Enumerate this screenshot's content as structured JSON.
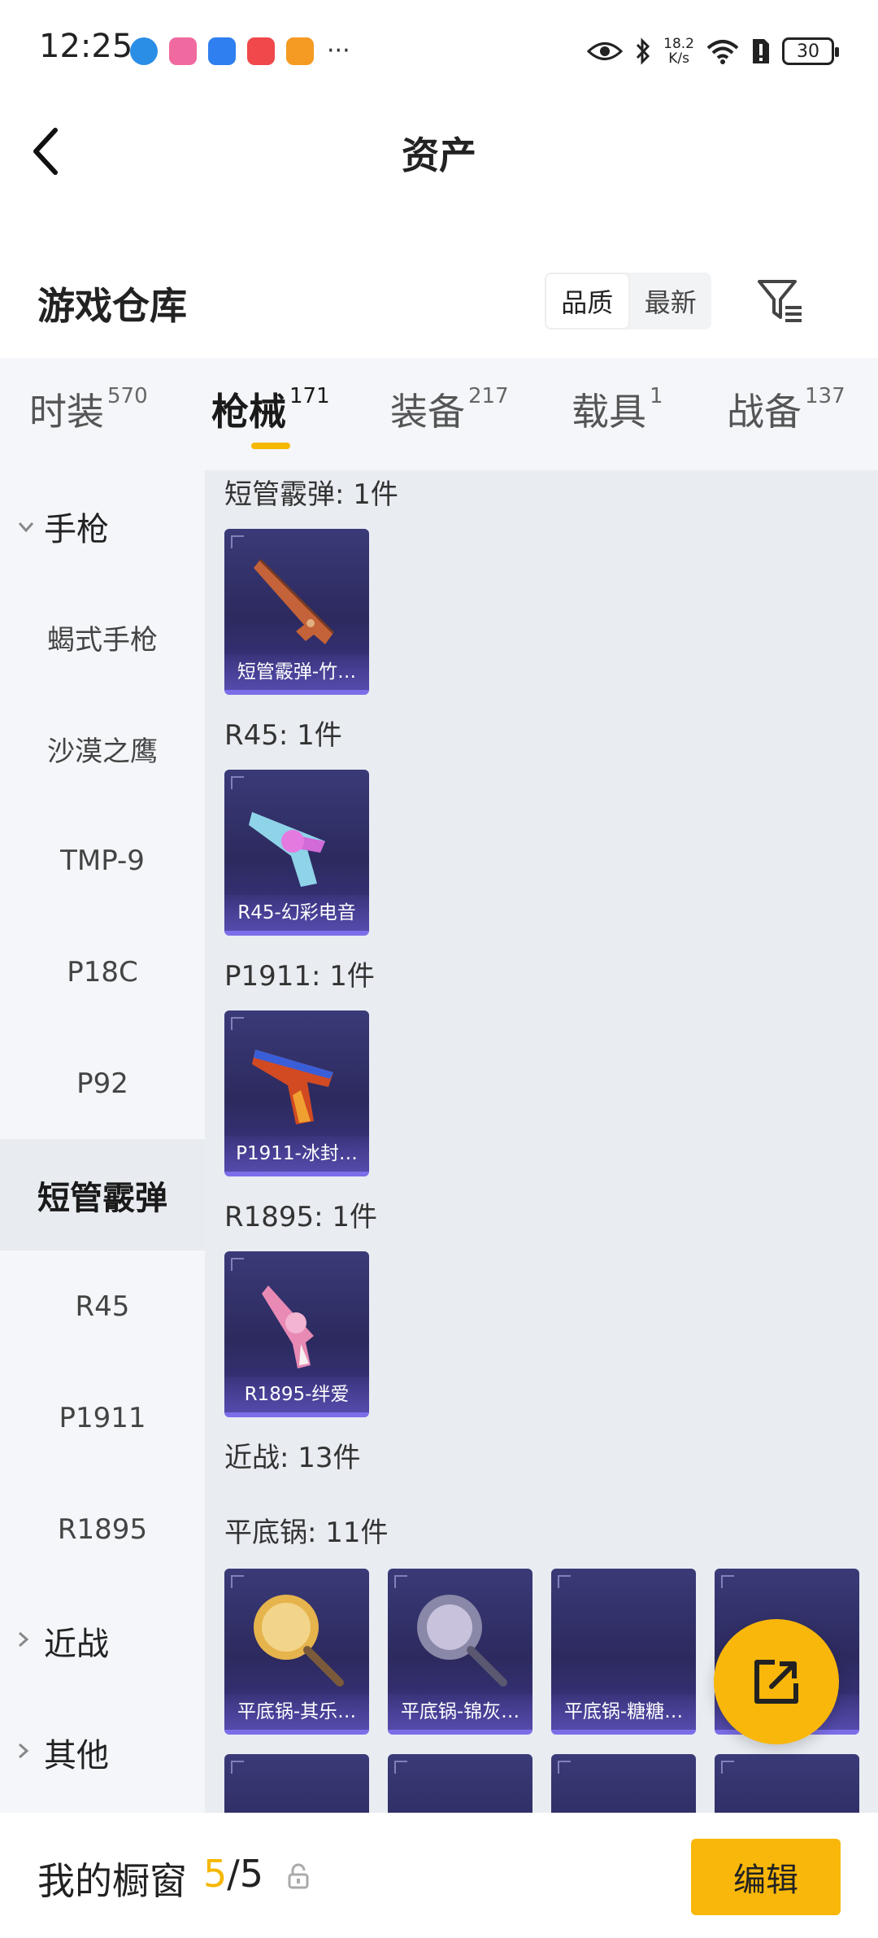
{
  "status_bar": {
    "time": "12:25",
    "net_speed_value": "18.2",
    "net_speed_unit": "K/s",
    "battery": "30",
    "more": "···"
  },
  "header": {
    "title": "资产"
  },
  "section": {
    "title": "游戏仓库",
    "sort_options": [
      "品质",
      "最新"
    ]
  },
  "tabs": [
    {
      "label": "时装",
      "count": "570"
    },
    {
      "label": "枪械",
      "count": "171"
    },
    {
      "label": "装备",
      "count": "217"
    },
    {
      "label": "载具",
      "count": "1"
    },
    {
      "label": "战备",
      "count": "137"
    }
  ],
  "sidebar": {
    "groups": [
      {
        "label": "手枪"
      },
      {
        "label": "近战"
      },
      {
        "label": "其他"
      }
    ],
    "items": [
      "蝎式手枪",
      "沙漠之鹰",
      "TMP-9",
      "P18C",
      "P92",
      "短管霰弹",
      "R45",
      "P1911",
      "R1895"
    ]
  },
  "content": {
    "groups": [
      {
        "label": "短管霰弹: 1件",
        "items": [
          "短管霰弹-竹…"
        ]
      },
      {
        "label": "R45: 1件",
        "items": [
          "R45-幻彩电音"
        ]
      },
      {
        "label": "P1911: 1件",
        "items": [
          "P1911-冰封…"
        ]
      },
      {
        "label": "R1895: 1件",
        "items": [
          "R1895-绊爱"
        ]
      },
      {
        "label": "近战: 13件",
        "items": []
      },
      {
        "label": "平底锅: 11件",
        "items": [
          "平底锅-其乐…",
          "平底锅-锦灰…",
          "平底锅-糖糖…",
          "…"
        ]
      }
    ]
  },
  "bottom": {
    "showcase_label": "我的橱窗",
    "count_current": "5",
    "count_sep": "/",
    "count_max": "5",
    "edit_label": "编辑"
  },
  "colors": {
    "accent": "#f8b70a",
    "card_bg": "#2c2a5e",
    "tab_bg": "#f4f6f9",
    "content_bg": "#e9ecf1"
  }
}
